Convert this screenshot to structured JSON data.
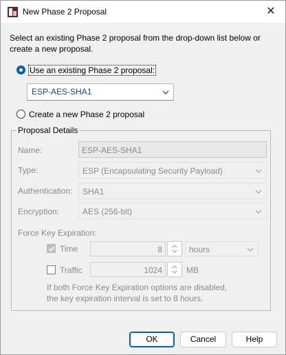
{
  "window": {
    "title": "New Phase 2 Proposal",
    "close_glyph": "✕"
  },
  "instruction": "Select an existing Phase 2 proposal from the drop-down list below or create a new proposal.",
  "options": {
    "use_existing_label": "Use an existing Phase 2 proposal:",
    "existing_selected": "ESP-AES-SHA1",
    "create_new_label": "Create a new Phase 2 proposal",
    "selected_option": "use_existing"
  },
  "details": {
    "group_label": "Proposal Details",
    "name_label": "Name:",
    "name_value": "ESP-AES-SHA1",
    "type_label": "Type:",
    "type_value": "ESP (Encapsulating Security Payload)",
    "auth_label": "Authentication:",
    "auth_value": "SHA1",
    "enc_label": "Encryption:",
    "enc_value": "AES (256-bit)",
    "force_label": "Force Key Expiration:",
    "time_label": "Time",
    "time_value": "8",
    "time_unit": "hours",
    "time_checked": true,
    "traffic_label": "Traffic",
    "traffic_value": "1024",
    "traffic_unit": "MB",
    "traffic_checked": false,
    "note": "If both Force Key Expiration options are disabled, the key expiration interval is set to 8 hours."
  },
  "buttons": {
    "ok": "OK",
    "cancel": "Cancel",
    "help": "Help"
  },
  "colors": {
    "accent": "#005fb8",
    "disabled_text": "#8a8a8a"
  }
}
